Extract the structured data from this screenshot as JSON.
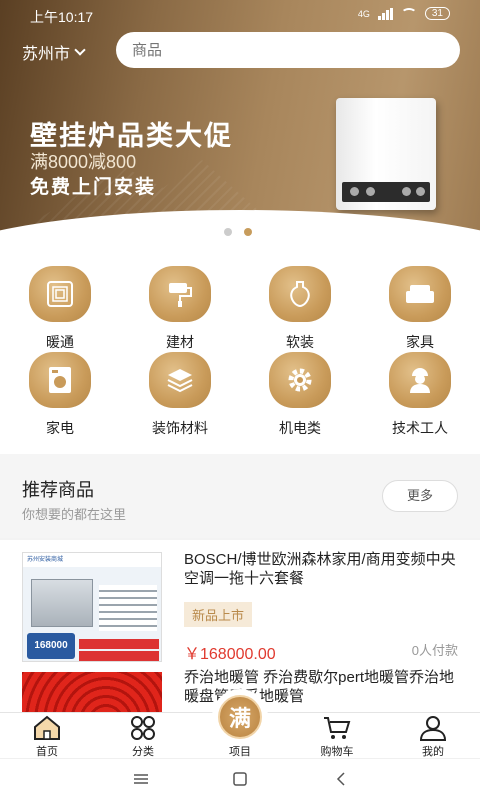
{
  "status": {
    "time": "上午10:17",
    "network": "4G",
    "battery": "31"
  },
  "header": {
    "city": "苏州市",
    "search_placeholder": "商品"
  },
  "banner": {
    "title": "壁挂炉品类大促",
    "subtitle": "满8000减800",
    "subtitle2": "免费上门安装",
    "slide_count": 2,
    "active_slide": 2
  },
  "categories": [
    {
      "label": "暖通",
      "icon": "heating-icon"
    },
    {
      "label": "建材",
      "icon": "paint-brush-icon"
    },
    {
      "label": "软装",
      "icon": "vase-icon"
    },
    {
      "label": "家具",
      "icon": "sofa-icon"
    },
    {
      "label": "家电",
      "icon": "washing-machine-icon"
    },
    {
      "label": "装饰材料",
      "icon": "tiles-icon"
    },
    {
      "label": "机电类",
      "icon": "gear-icon"
    },
    {
      "label": "技术工人",
      "icon": "worker-icon"
    }
  ],
  "recommend": {
    "title": "推荐商品",
    "subtitle": "你想要的都在这里",
    "more": "更多"
  },
  "products": [
    {
      "name": "BOSCH/博世欧洲森林家用/商用变频中央空调一拖十六套餐",
      "badge": "新品上市",
      "price": "￥168000.00",
      "paid": "0人付款",
      "thumb_header": "苏州安装商城",
      "thumb_price_label": "168000"
    },
    {
      "name": "乔治地暖管 乔治费歇尔pert地暖管乔治地暖盘管乔孚地暖管"
    }
  ],
  "tabs": [
    {
      "label": "首页",
      "icon": "home-icon"
    },
    {
      "label": "分类",
      "icon": "category-icon"
    },
    {
      "label": "项目",
      "icon": "project-icon",
      "badge_text": "满"
    },
    {
      "label": "购物车",
      "icon": "cart-icon"
    },
    {
      "label": "我的",
      "icon": "user-icon"
    }
  ],
  "colors": {
    "accent": "#c99b5a",
    "price": "#e03a2f",
    "badge_bg": "#f6ead8"
  }
}
